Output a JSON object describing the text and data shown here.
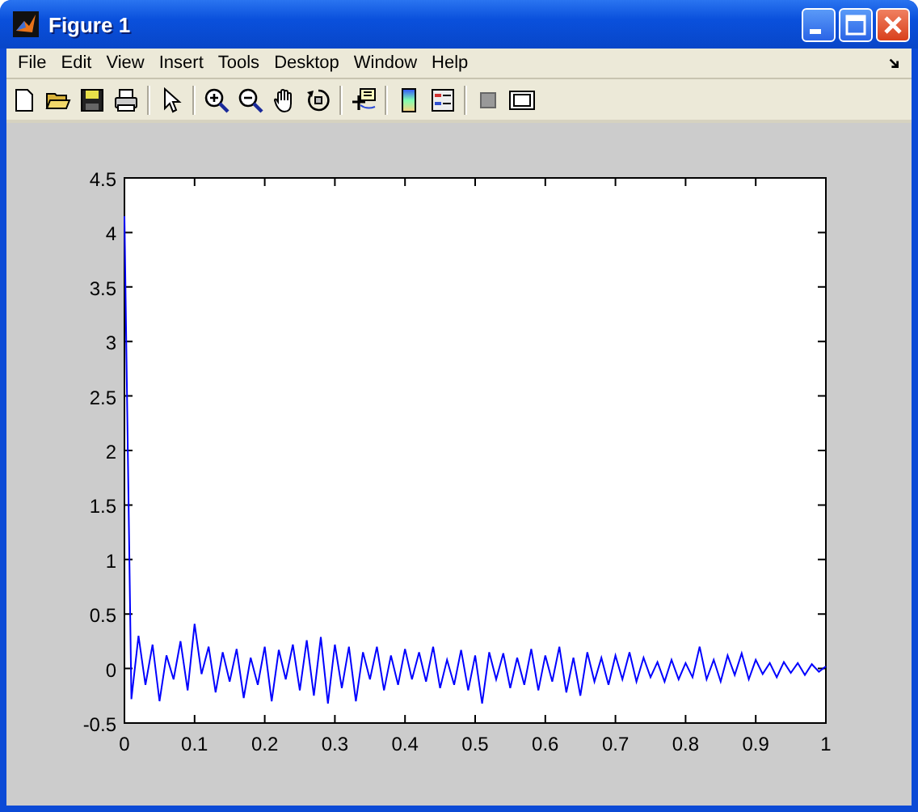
{
  "window": {
    "title": "Figure 1"
  },
  "menu": [
    "File",
    "Edit",
    "View",
    "Insert",
    "Tools",
    "Desktop",
    "Window",
    "Help"
  ],
  "chart_data": {
    "type": "line",
    "xlim": [
      0,
      1
    ],
    "ylim": [
      -0.5,
      4.5
    ],
    "xticks": [
      0,
      0.1,
      0.2,
      0.3,
      0.4,
      0.5,
      0.6,
      0.7,
      0.8,
      0.9,
      1
    ],
    "yticks": [
      4.5,
      4,
      3.5,
      3,
      2.5,
      2,
      1.5,
      1,
      0.5,
      0,
      -0.5
    ],
    "x": [
      0,
      0.01,
      0.02,
      0.03,
      0.04,
      0.05,
      0.06,
      0.07,
      0.08,
      0.09,
      0.1,
      0.11,
      0.12,
      0.13,
      0.14,
      0.15,
      0.16,
      0.17,
      0.18,
      0.19,
      0.2,
      0.21,
      0.22,
      0.23,
      0.24,
      0.25,
      0.26,
      0.27,
      0.28,
      0.29,
      0.3,
      0.31,
      0.32,
      0.33,
      0.34,
      0.35,
      0.36,
      0.37,
      0.38,
      0.39,
      0.4,
      0.41,
      0.42,
      0.43,
      0.44,
      0.45,
      0.46,
      0.47,
      0.48,
      0.49,
      0.5,
      0.51,
      0.52,
      0.53,
      0.54,
      0.55,
      0.56,
      0.57,
      0.58,
      0.59,
      0.6,
      0.61,
      0.62,
      0.63,
      0.64,
      0.65,
      0.66,
      0.67,
      0.68,
      0.69,
      0.7,
      0.71,
      0.72,
      0.73,
      0.74,
      0.75,
      0.76,
      0.77,
      0.78,
      0.79,
      0.8,
      0.81,
      0.82,
      0.83,
      0.84,
      0.85,
      0.86,
      0.87,
      0.88,
      0.89,
      0.9,
      0.91,
      0.92,
      0.93,
      0.94,
      0.95,
      0.96,
      0.97,
      0.98,
      0.99,
      1
    ],
    "series": [
      {
        "color": "#0000ff",
        "values": [
          4.15,
          -0.28,
          0.3,
          -0.15,
          0.22,
          -0.3,
          0.12,
          -0.1,
          0.25,
          -0.2,
          0.41,
          -0.05,
          0.2,
          -0.22,
          0.15,
          -0.12,
          0.18,
          -0.27,
          0.1,
          -0.15,
          0.2,
          -0.3,
          0.17,
          -0.1,
          0.22,
          -0.2,
          0.26,
          -0.25,
          0.29,
          -0.32,
          0.22,
          -0.18,
          0.2,
          -0.3,
          0.15,
          -0.1,
          0.2,
          -0.2,
          0.12,
          -0.15,
          0.18,
          -0.1,
          0.15,
          -0.12,
          0.2,
          -0.18,
          0.08,
          -0.15,
          0.17,
          -0.2,
          0.12,
          -0.32,
          0.15,
          -0.1,
          0.14,
          -0.18,
          0.1,
          -0.15,
          0.18,
          -0.2,
          0.12,
          -0.12,
          0.2,
          -0.22,
          0.1,
          -0.25,
          0.15,
          -0.12,
          0.1,
          -0.15,
          0.12,
          -0.1,
          0.15,
          -0.12,
          0.1,
          -0.08,
          0.06,
          -0.12,
          0.08,
          -0.1,
          0.05,
          -0.08,
          0.2,
          -0.1,
          0.08,
          -0.12,
          0.12,
          -0.06,
          0.14,
          -0.1,
          0.08,
          -0.05,
          0.05,
          -0.08,
          0.06,
          -0.04,
          0.05,
          -0.06,
          0.04,
          -0.03,
          0.02
        ]
      }
    ]
  }
}
